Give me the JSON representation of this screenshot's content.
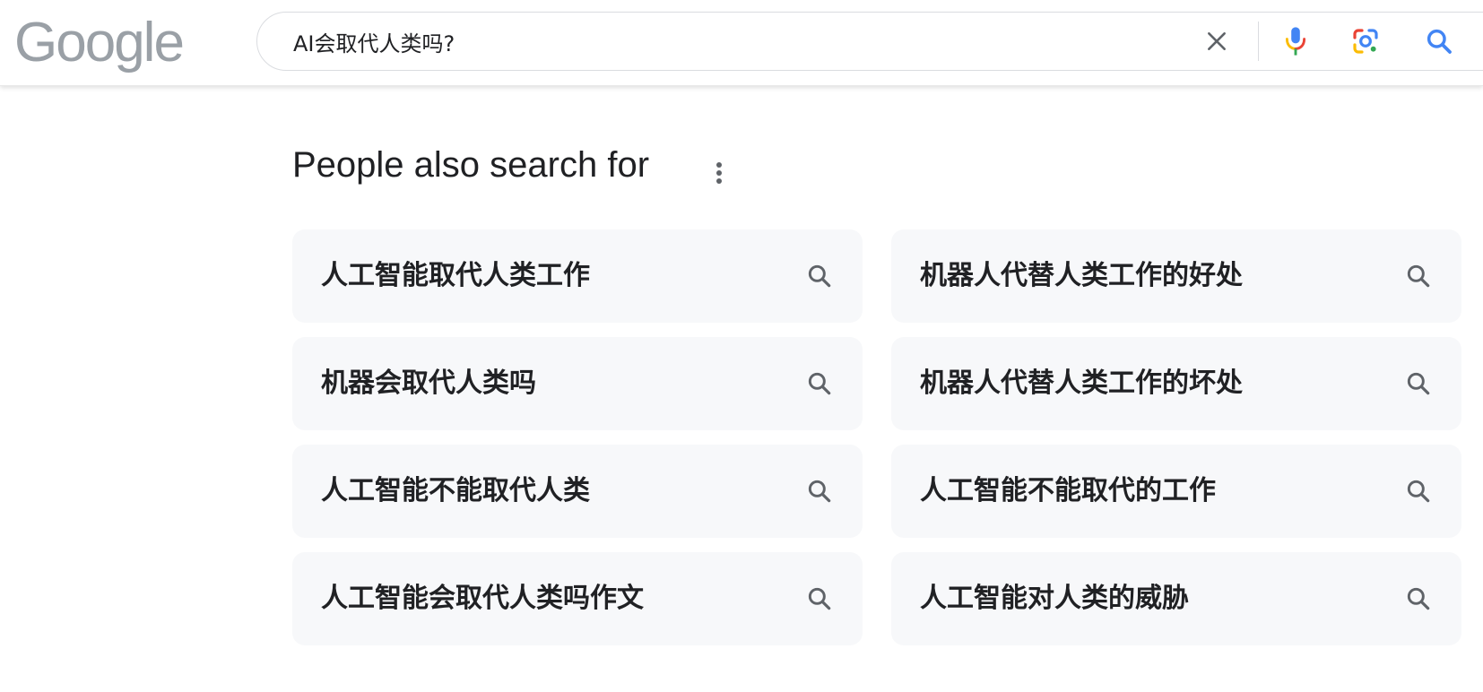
{
  "header": {
    "logo_text": "Google",
    "search_value": "AI会取代人类吗?",
    "icons": [
      "close-icon",
      "microphone-icon",
      "lens-camera-icon",
      "search-icon"
    ]
  },
  "section": {
    "title": "People also search for",
    "more_icon": "more-vert-icon"
  },
  "suggestions": [
    {
      "label": "人工智能取代人类工作"
    },
    {
      "label": "机器人代替人类工作的好处"
    },
    {
      "label": "机器会取代人类吗"
    },
    {
      "label": "机器人代替人类工作的坏处"
    },
    {
      "label": "人工智能不能取代人类"
    },
    {
      "label": "人工智能不能取代的工作"
    },
    {
      "label": "人工智能会取代人类吗作文"
    },
    {
      "label": "人工智能对人类的威胁"
    }
  ],
  "colors": {
    "accent_blue": "#4285f4",
    "red": "#ea4335",
    "yellow": "#fbbc05",
    "green": "#34a853",
    "chip_bg": "#f7f8fa"
  }
}
